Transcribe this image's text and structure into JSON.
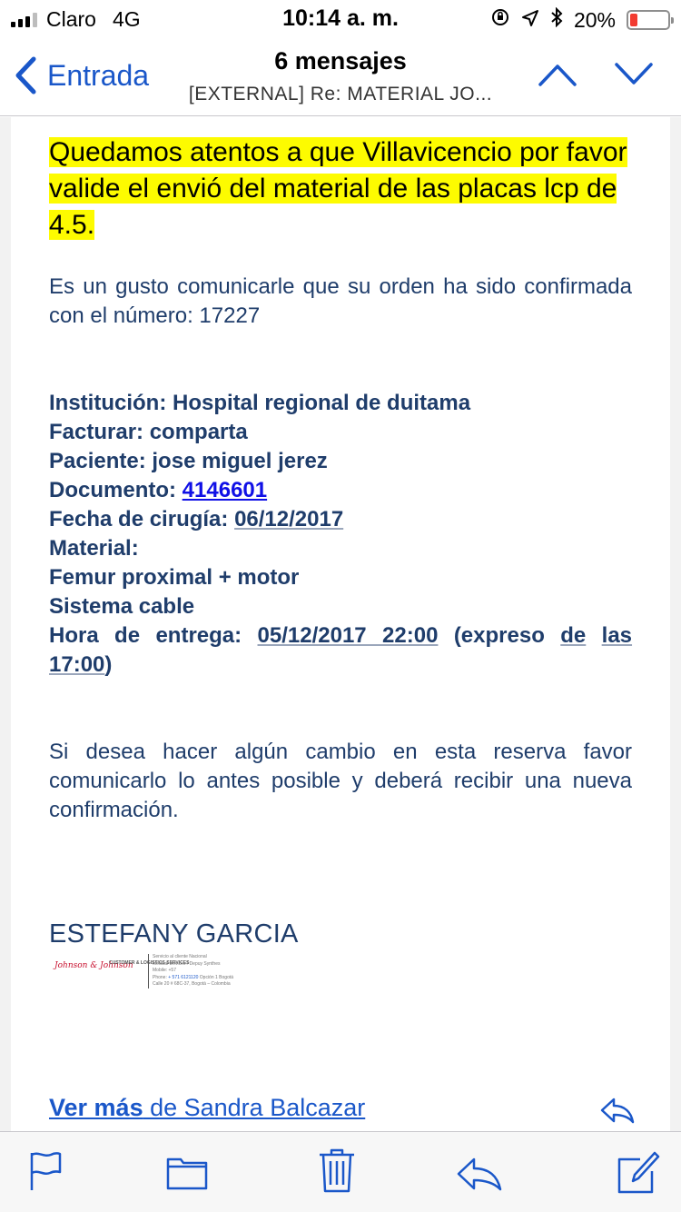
{
  "status_bar": {
    "carrier": "Claro",
    "network": "4G",
    "time": "10:14 a. m.",
    "battery": "20%",
    "battery_level": 0.2,
    "battery_color": "#f23b30"
  },
  "nav": {
    "back_label": "Entrada",
    "title": "6 mensajes",
    "subtitle": "[EXTERNAL]  Re: MATERIAL JO..."
  },
  "message": {
    "highlight": "Quedamos atentos a que Villavicencio por favor valide el envió del material de las placas lcp de 4.5.",
    "intro": "Es un gusto comunicarle que su orden ha sido confirmada con el número: 17227",
    "institution_label": "Institución:",
    "institution_value": "Hospital regional de duitama",
    "bill_label": "Facturar:",
    "bill_value": "comparta",
    "patient_label": "Paciente:",
    "patient_value": "jose miguel jerez",
    "document_label": "Documento:",
    "document_value": "4146601",
    "surgery_label": "Fecha de cirugía:",
    "surgery_value": "06/12/2017",
    "material_label": "Material:",
    "material_items": [
      "Femur proximal + motor",
      "Sistema cable"
    ],
    "delivery_label": "Hora de entrega:",
    "delivery_value": "05/12/2017 22:00",
    "delivery_note_pre": "(expreso",
    "delivery_note_de": "de",
    "delivery_note_las": "las",
    "delivery_note_time": "17:00",
    "delivery_note_close": ")",
    "closing": "Si desea hacer algún cambio en esta reserva favor comunicarlo lo antes posible y deberá recibir una nueva confirmación.",
    "signature_name": "ESTEFANY GARCIA",
    "signature_logo": "Johnson & Johnson",
    "signature_dept": "CUSTOMER & LOGISTICS SERVICES",
    "signature_lines": [
      "Servicio al cliente Nacional",
      "Medical Devices / Depuy Synthes",
      "Mobile: +57",
      "Opción 1 Bogotá",
      "Calle 20 # 68C-37, Bogotá – Colombia"
    ],
    "signature_phone_label": "Phone:",
    "signature_phone": "+ 571 6121120"
  },
  "thread": {
    "ver_mas": "Ver más",
    "from": " de Sandra Balcazar"
  },
  "toolbar": {
    "icons": [
      "flag-icon",
      "folder-icon",
      "trash-icon",
      "reply-icon",
      "compose-icon"
    ]
  },
  "colors": {
    "link": "#1a57c9",
    "body_text": "#1f3d6b",
    "highlight": "#fdfb00"
  }
}
